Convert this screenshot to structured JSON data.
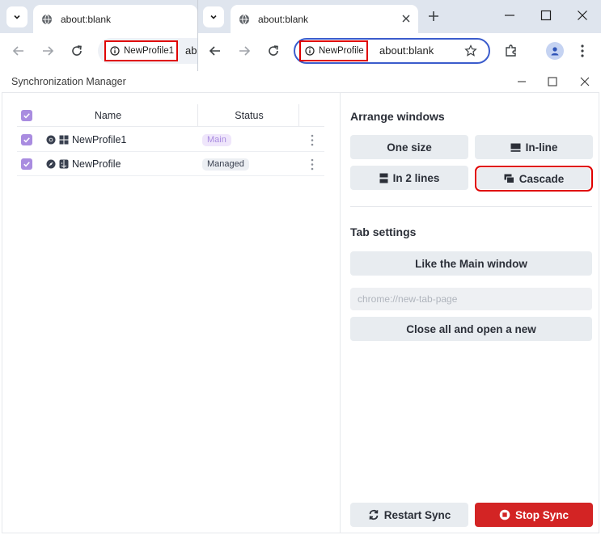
{
  "browser_back": {
    "tab_title": "about:blank",
    "profile_chip": "NewProfile1",
    "url_partial": "abo"
  },
  "browser_front": {
    "tab_title": "about:blank",
    "profile_chip": "NewProfile",
    "url": "about:blank"
  },
  "app": {
    "title": "Synchronization Manager"
  },
  "table": {
    "headers": {
      "name": "Name",
      "status": "Status"
    },
    "rows": [
      {
        "name": "NewProfile1",
        "status": "Main",
        "browser_icon": "chrome-icon",
        "os_icon": "windows-icon",
        "checked": true
      },
      {
        "name": "NewProfile",
        "status": "Managed",
        "browser_icon": "compass-icon",
        "os_icon": "finder-icon",
        "checked": true
      }
    ]
  },
  "arrange": {
    "title": "Arrange windows",
    "one_size": "One size",
    "inline": "In-line",
    "two_lines": "In 2 lines",
    "cascade": "Cascade"
  },
  "tab_settings": {
    "title": "Tab settings",
    "like_main": "Like the Main window",
    "url_placeholder": "chrome://new-tab-page",
    "close_all": "Close all and open a new"
  },
  "footer": {
    "restart": "Restart Sync",
    "stop": "Stop Sync"
  },
  "colors": {
    "accent_purple": "#a98ce0",
    "highlight_red": "#e00000",
    "stop_red": "#d32424",
    "button_bg": "#e8ecf0"
  }
}
